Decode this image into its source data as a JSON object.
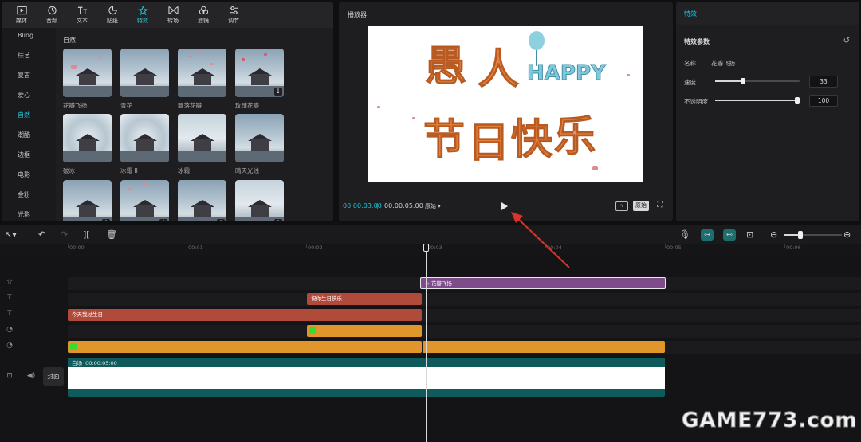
{
  "categories": [
    {
      "label": "媒体",
      "icon": "media-icon"
    },
    {
      "label": "音频",
      "icon": "audio-icon"
    },
    {
      "label": "文本",
      "icon": "text-icon"
    },
    {
      "label": "贴纸",
      "icon": "sticker-icon"
    },
    {
      "label": "特效",
      "icon": "effects-icon",
      "active": true
    },
    {
      "label": "转场",
      "icon": "transition-icon"
    },
    {
      "label": "滤镜",
      "icon": "filter-icon"
    },
    {
      "label": "调节",
      "icon": "adjust-icon"
    }
  ],
  "subcategories": [
    "Bling",
    "综艺",
    "复古",
    "爱心",
    "自然",
    "潮酷",
    "边框",
    "电影",
    "金粉",
    "光影"
  ],
  "active_subcategory": "自然",
  "grid": {
    "title": "自然",
    "items": [
      {
        "label": "花瓣飞扬"
      },
      {
        "label": "雪花"
      },
      {
        "label": "飘落花瓣"
      },
      {
        "label": "玫瑰花瓣"
      },
      {
        "label": "破冰"
      },
      {
        "label": "冰霜 II"
      },
      {
        "label": "冰霜"
      },
      {
        "label": "晴天光线"
      },
      {
        "label": ""
      },
      {
        "label": ""
      },
      {
        "label": ""
      },
      {
        "label": ""
      }
    ]
  },
  "player": {
    "title": "播放器",
    "current_time": "00:00:03:00",
    "total_time": "00:00:05:00",
    "ratio": "原始",
    "original_button": "原始",
    "canvas_text": [
      "愚",
      "人",
      "节",
      "日",
      "快",
      "乐"
    ],
    "happy_text": "HAPPY"
  },
  "properties": {
    "tab": "特效",
    "section": "特效参数",
    "name_label": "名称",
    "name_value": "花瓣飞扬",
    "speed_label": "速度",
    "speed_value": "33",
    "speed_fraction": 0.33,
    "opacity_label": "不透明度",
    "opacity_value": "100",
    "opacity_fraction": 1.0
  },
  "ruler": {
    "labels": [
      "00:00",
      "00:01",
      "00:02",
      "00:03",
      "00:04",
      "00:05",
      "00:06"
    ]
  },
  "tracks": {
    "effect_clip": "花瓣飞扬",
    "text_clip_1": "祝你生日快乐",
    "text_clip_2": "今天我过生日",
    "main_label": "白场",
    "main_duration": "00:00:05:00",
    "cover_button": "封面"
  },
  "watermark": "GAME773.com"
}
